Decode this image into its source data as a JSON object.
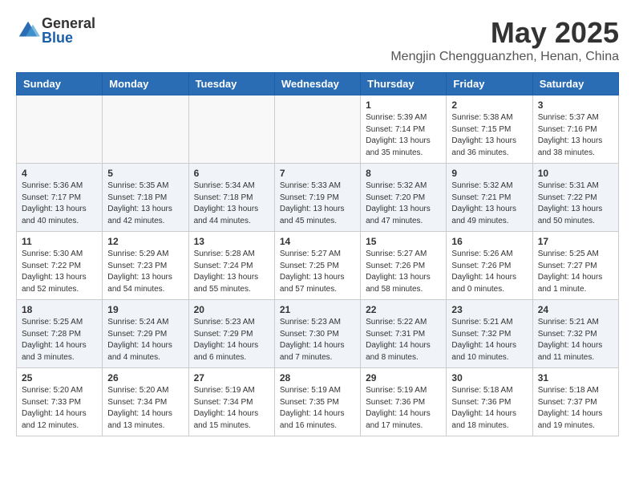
{
  "logo": {
    "general": "General",
    "blue": "Blue"
  },
  "title": "May 2025",
  "subtitle": "Mengjin Chengguanzhen, Henan, China",
  "days": [
    "Sunday",
    "Monday",
    "Tuesday",
    "Wednesday",
    "Thursday",
    "Friday",
    "Saturday"
  ],
  "weeks": [
    [
      {
        "num": "",
        "info": ""
      },
      {
        "num": "",
        "info": ""
      },
      {
        "num": "",
        "info": ""
      },
      {
        "num": "",
        "info": ""
      },
      {
        "num": "1",
        "info": "Sunrise: 5:39 AM\nSunset: 7:14 PM\nDaylight: 13 hours\nand 35 minutes."
      },
      {
        "num": "2",
        "info": "Sunrise: 5:38 AM\nSunset: 7:15 PM\nDaylight: 13 hours\nand 36 minutes."
      },
      {
        "num": "3",
        "info": "Sunrise: 5:37 AM\nSunset: 7:16 PM\nDaylight: 13 hours\nand 38 minutes."
      }
    ],
    [
      {
        "num": "4",
        "info": "Sunrise: 5:36 AM\nSunset: 7:17 PM\nDaylight: 13 hours\nand 40 minutes."
      },
      {
        "num": "5",
        "info": "Sunrise: 5:35 AM\nSunset: 7:18 PM\nDaylight: 13 hours\nand 42 minutes."
      },
      {
        "num": "6",
        "info": "Sunrise: 5:34 AM\nSunset: 7:18 PM\nDaylight: 13 hours\nand 44 minutes."
      },
      {
        "num": "7",
        "info": "Sunrise: 5:33 AM\nSunset: 7:19 PM\nDaylight: 13 hours\nand 45 minutes."
      },
      {
        "num": "8",
        "info": "Sunrise: 5:32 AM\nSunset: 7:20 PM\nDaylight: 13 hours\nand 47 minutes."
      },
      {
        "num": "9",
        "info": "Sunrise: 5:32 AM\nSunset: 7:21 PM\nDaylight: 13 hours\nand 49 minutes."
      },
      {
        "num": "10",
        "info": "Sunrise: 5:31 AM\nSunset: 7:22 PM\nDaylight: 13 hours\nand 50 minutes."
      }
    ],
    [
      {
        "num": "11",
        "info": "Sunrise: 5:30 AM\nSunset: 7:22 PM\nDaylight: 13 hours\nand 52 minutes."
      },
      {
        "num": "12",
        "info": "Sunrise: 5:29 AM\nSunset: 7:23 PM\nDaylight: 13 hours\nand 54 minutes."
      },
      {
        "num": "13",
        "info": "Sunrise: 5:28 AM\nSunset: 7:24 PM\nDaylight: 13 hours\nand 55 minutes."
      },
      {
        "num": "14",
        "info": "Sunrise: 5:27 AM\nSunset: 7:25 PM\nDaylight: 13 hours\nand 57 minutes."
      },
      {
        "num": "15",
        "info": "Sunrise: 5:27 AM\nSunset: 7:26 PM\nDaylight: 13 hours\nand 58 minutes."
      },
      {
        "num": "16",
        "info": "Sunrise: 5:26 AM\nSunset: 7:26 PM\nDaylight: 14 hours\nand 0 minutes."
      },
      {
        "num": "17",
        "info": "Sunrise: 5:25 AM\nSunset: 7:27 PM\nDaylight: 14 hours\nand 1 minute."
      }
    ],
    [
      {
        "num": "18",
        "info": "Sunrise: 5:25 AM\nSunset: 7:28 PM\nDaylight: 14 hours\nand 3 minutes."
      },
      {
        "num": "19",
        "info": "Sunrise: 5:24 AM\nSunset: 7:29 PM\nDaylight: 14 hours\nand 4 minutes."
      },
      {
        "num": "20",
        "info": "Sunrise: 5:23 AM\nSunset: 7:29 PM\nDaylight: 14 hours\nand 6 minutes."
      },
      {
        "num": "21",
        "info": "Sunrise: 5:23 AM\nSunset: 7:30 PM\nDaylight: 14 hours\nand 7 minutes."
      },
      {
        "num": "22",
        "info": "Sunrise: 5:22 AM\nSunset: 7:31 PM\nDaylight: 14 hours\nand 8 minutes."
      },
      {
        "num": "23",
        "info": "Sunrise: 5:21 AM\nSunset: 7:32 PM\nDaylight: 14 hours\nand 10 minutes."
      },
      {
        "num": "24",
        "info": "Sunrise: 5:21 AM\nSunset: 7:32 PM\nDaylight: 14 hours\nand 11 minutes."
      }
    ],
    [
      {
        "num": "25",
        "info": "Sunrise: 5:20 AM\nSunset: 7:33 PM\nDaylight: 14 hours\nand 12 minutes."
      },
      {
        "num": "26",
        "info": "Sunrise: 5:20 AM\nSunset: 7:34 PM\nDaylight: 14 hours\nand 13 minutes."
      },
      {
        "num": "27",
        "info": "Sunrise: 5:19 AM\nSunset: 7:34 PM\nDaylight: 14 hours\nand 15 minutes."
      },
      {
        "num": "28",
        "info": "Sunrise: 5:19 AM\nSunset: 7:35 PM\nDaylight: 14 hours\nand 16 minutes."
      },
      {
        "num": "29",
        "info": "Sunrise: 5:19 AM\nSunset: 7:36 PM\nDaylight: 14 hours\nand 17 minutes."
      },
      {
        "num": "30",
        "info": "Sunrise: 5:18 AM\nSunset: 7:36 PM\nDaylight: 14 hours\nand 18 minutes."
      },
      {
        "num": "31",
        "info": "Sunrise: 5:18 AM\nSunset: 7:37 PM\nDaylight: 14 hours\nand 19 minutes."
      }
    ]
  ]
}
